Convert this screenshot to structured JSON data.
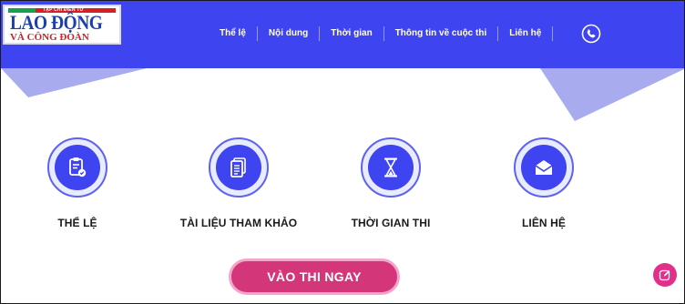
{
  "logo": {
    "tagline": "TẠP CHÍ ĐIỆN TỬ",
    "main": "LAO ĐỘNG",
    "sub": "VÀ CÔNG ĐOÀN"
  },
  "nav": {
    "items": [
      "Thể lệ",
      "Nội dung",
      "Thời gian",
      "Thông tin về cuộc thi",
      "Liên hệ"
    ],
    "phone_icon": "phone-icon"
  },
  "features": [
    {
      "label": "THỂ LỆ",
      "icon": "clipboard-check-icon"
    },
    {
      "label": "TÀI LIỆU THAM KHẢO",
      "icon": "documents-icon"
    },
    {
      "label": "THỜI GIAN THI",
      "icon": "hourglass-icon"
    },
    {
      "label": "LIÊN HỆ",
      "icon": "envelope-icon"
    }
  ],
  "cta": {
    "label": "VÀO THI NGAY"
  },
  "fab": {
    "icon": "edit-icon"
  },
  "colors": {
    "header": "#3e44f0",
    "accent": "#d4367a",
    "icon_ring": "#e9ebff",
    "logo_blue": "#1d3fa8",
    "logo_red": "#d61f26"
  }
}
